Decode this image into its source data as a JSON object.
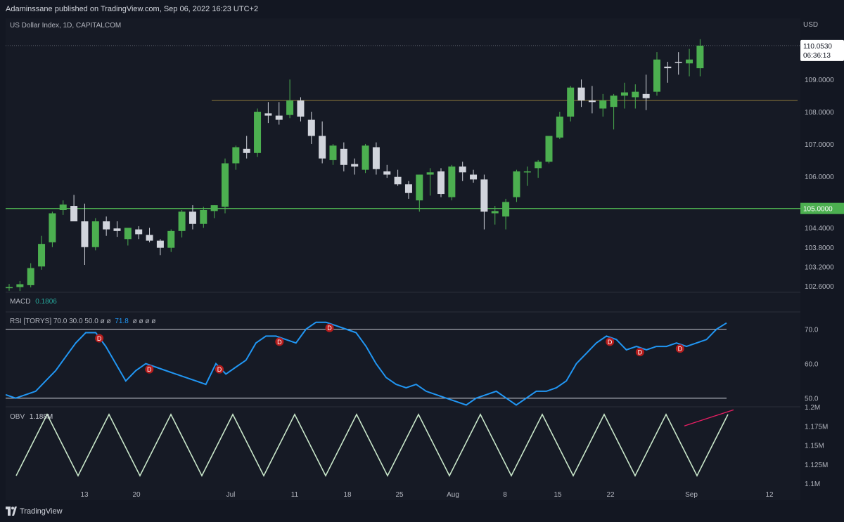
{
  "header": {
    "publisher": "Adaminssane published on TradingView.com, Sep 06, 2022 16:23 UTC+2"
  },
  "main_pane": {
    "symbol_title": "US Dollar Index, 1D, CAPITALCOM",
    "currency": "USD",
    "last_price": "110.0530",
    "countdown": "06:36:13",
    "support_label": "105.0000",
    "price_ticks": [
      "109.0000",
      "108.0000",
      "107.0000",
      "106.0000",
      "104.4000",
      "103.8000",
      "103.2000",
      "102.6000"
    ]
  },
  "macd": {
    "label": "MACD",
    "value": "0.1806"
  },
  "rsi": {
    "label": "RSI [TORYS] 70.0 30.0 50.0 ø ø",
    "value": "71.8",
    "tail": "ø ø ø ø",
    "ticks": [
      "70.0",
      "60.0",
      "50.0"
    ],
    "divergence_marker": "D"
  },
  "obv": {
    "label": "OBV",
    "value": "1.188M",
    "ticks": [
      "1.2M",
      "1.175M",
      "1.15M",
      "1.125M",
      "1.1M"
    ]
  },
  "time_axis": [
    "13",
    "20",
    "Jul",
    "11",
    "18",
    "25",
    "Aug",
    "8",
    "15",
    "22",
    "Sep",
    "12"
  ],
  "footer": {
    "brand": "TradingView"
  },
  "colors": {
    "up": "#4caf50",
    "down": "#d1d4dc",
    "rsi": "#2196f3",
    "obv": "#c8e6c9",
    "support": "#4caf50",
    "resistance": "#8d7a3a",
    "divergence": "#b71c1c",
    "trendline": "#e91e63"
  },
  "chart_data": [
    {
      "type": "candlestick",
      "title": "US Dollar Index, 1D, CAPITALCOM",
      "ylabel": "USD",
      "ylim": [
        102.4,
        110.9
      ],
      "x": [
        "Jun 8",
        "Jun 9",
        "Jun 10",
        "Jun 13",
        "Jun 14",
        "Jun 15",
        "Jun 16",
        "Jun 17",
        "Jun 20",
        "Jun 21",
        "Jun 22",
        "Jun 23",
        "Jun 24",
        "Jun 27",
        "Jun 28",
        "Jun 29",
        "Jun 30",
        "Jul 1",
        "Jul 4",
        "Jul 5",
        "Jul 6",
        "Jul 7",
        "Jul 8",
        "Jul 11",
        "Jul 12",
        "Jul 13",
        "Jul 14",
        "Jul 15",
        "Jul 18",
        "Jul 19",
        "Jul 20",
        "Jul 21",
        "Jul 22",
        "Jul 25",
        "Jul 26",
        "Jul 27",
        "Jul 28",
        "Jul 29",
        "Aug 1",
        "Aug 2",
        "Aug 3",
        "Aug 4",
        "Aug 5",
        "Aug 8",
        "Aug 9",
        "Aug 10",
        "Aug 11",
        "Aug 12",
        "Aug 15",
        "Aug 16",
        "Aug 17",
        "Aug 18",
        "Aug 19",
        "Aug 22",
        "Aug 23",
        "Aug 24",
        "Aug 25",
        "Aug 26",
        "Aug 29",
        "Aug 30",
        "Aug 31",
        "Sep 1",
        "Sep 2",
        "Sep 5",
        "Sep 6"
      ],
      "ohlc": [
        [
          102.55,
          102.66,
          102.45,
          102.56
        ],
        [
          102.56,
          102.75,
          102.44,
          102.65
        ],
        [
          102.62,
          103.3,
          102.55,
          103.15
        ],
        [
          103.2,
          104.15,
          103.1,
          103.9
        ],
        [
          103.95,
          104.9,
          103.8,
          104.85
        ],
        [
          104.95,
          105.25,
          104.8,
          105.12
        ],
        [
          105.08,
          105.42,
          104.85,
          104.6
        ],
        [
          104.6,
          105.15,
          103.25,
          103.8
        ],
        [
          103.8,
          104.7,
          103.7,
          104.6
        ],
        [
          104.6,
          104.75,
          104.15,
          104.35
        ],
        [
          104.38,
          104.6,
          104.12,
          104.3
        ],
        [
          104.05,
          104.35,
          103.85,
          104.4
        ],
        [
          104.35,
          104.45,
          104.05,
          104.2
        ],
        [
          104.18,
          104.4,
          103.95,
          104.0
        ],
        [
          104.0,
          104.05,
          103.55,
          103.78
        ],
        [
          103.78,
          104.35,
          103.65,
          104.3
        ],
        [
          104.3,
          104.95,
          104.1,
          104.9
        ],
        [
          104.9,
          105.1,
          104.35,
          104.52
        ],
        [
          104.52,
          105.05,
          104.4,
          104.95
        ],
        [
          104.92,
          105.1,
          104.7,
          105.1
        ],
        [
          105.05,
          106.55,
          104.85,
          106.4
        ],
        [
          106.4,
          106.95,
          106.2,
          106.9
        ],
        [
          106.85,
          107.25,
          106.55,
          106.72
        ],
        [
          106.72,
          108.1,
          106.6,
          108.0
        ],
        [
          107.95,
          108.3,
          107.65,
          107.88
        ],
        [
          107.88,
          108.3,
          107.6,
          107.75
        ],
        [
          107.9,
          109.0,
          107.8,
          108.35
        ],
        [
          108.35,
          108.45,
          107.7,
          107.85
        ],
        [
          107.75,
          108.0,
          107.0,
          107.25
        ],
        [
          107.25,
          107.7,
          106.4,
          106.55
        ],
        [
          106.5,
          107.0,
          106.35,
          106.95
        ],
        [
          106.85,
          107.05,
          106.15,
          106.35
        ],
        [
          106.38,
          106.55,
          106.05,
          106.3
        ],
        [
          106.2,
          107.0,
          106.1,
          106.95
        ],
        [
          106.9,
          107.05,
          106.05,
          106.22
        ],
        [
          106.15,
          106.35,
          105.95,
          106.05
        ],
        [
          105.98,
          106.2,
          105.7,
          105.75
        ],
        [
          105.75,
          105.85,
          105.3,
          105.48
        ],
        [
          105.25,
          106.05,
          104.9,
          106.05
        ],
        [
          106.05,
          106.25,
          105.4,
          106.12
        ],
        [
          106.15,
          106.25,
          105.35,
          105.45
        ],
        [
          105.35,
          106.35,
          105.25,
          106.3
        ],
        [
          106.3,
          106.45,
          105.85,
          106.12
        ],
        [
          106.05,
          106.2,
          105.8,
          105.9
        ],
        [
          105.9,
          106.05,
          104.35,
          104.9
        ],
        [
          104.85,
          105.08,
          104.5,
          104.92
        ],
        [
          104.75,
          105.3,
          104.35,
          105.2
        ],
        [
          105.35,
          106.2,
          105.2,
          106.15
        ],
        [
          106.12,
          106.3,
          105.7,
          106.15
        ],
        [
          106.25,
          106.5,
          105.95,
          106.45
        ],
        [
          106.45,
          107.25,
          106.4,
          107.25
        ],
        [
          107.2,
          108.0,
          107.15,
          107.85
        ],
        [
          107.85,
          108.8,
          107.7,
          108.75
        ],
        [
          108.75,
          109.0,
          108.15,
          108.35
        ],
        [
          108.35,
          108.8,
          107.95,
          108.3
        ],
        [
          108.1,
          108.55,
          107.85,
          108.35
        ],
        [
          108.15,
          108.55,
          107.45,
          108.5
        ],
        [
          108.5,
          108.9,
          108.1,
          108.6
        ],
        [
          108.45,
          108.85,
          108.1,
          108.62
        ],
        [
          108.55,
          109.15,
          108.05,
          108.42
        ],
        [
          108.62,
          109.85,
          108.5,
          109.62
        ],
        [
          109.4,
          109.55,
          108.9,
          109.35
        ],
        [
          109.55,
          109.85,
          109.15,
          109.52
        ],
        [
          109.5,
          109.95,
          109.1,
          109.62
        ],
        [
          109.35,
          110.25,
          109.1,
          110.05
        ]
      ],
      "horizontal_levels": [
        105.0,
        108.35,
        110.053
      ]
    },
    {
      "type": "line",
      "title": "RSI [TORYS]",
      "ylim": [
        47.5,
        75
      ],
      "levels": [
        70.0,
        50.0
      ],
      "series": [
        {
          "name": "RSI",
          "values": [
            51,
            50,
            51,
            52,
            55,
            58,
            62,
            66,
            69,
            69,
            65,
            60,
            55,
            58,
            60,
            59,
            58,
            57,
            56,
            55,
            54,
            60,
            57,
            59,
            61,
            66,
            68,
            68,
            67,
            66,
            70,
            72,
            72,
            71,
            70,
            69,
            65,
            60,
            56,
            54,
            53,
            54,
            52,
            51,
            50,
            49,
            48,
            50,
            51,
            52,
            50,
            48,
            50,
            52,
            52,
            53,
            55,
            60,
            63,
            66,
            68,
            67,
            64,
            65,
            64,
            65,
            65,
            66,
            65,
            66,
            67,
            70,
            71.8
          ]
        }
      ],
      "divergence_markers": 8
    },
    {
      "type": "line",
      "title": "OBV",
      "ylim": [
        1.1,
        1.2
      ],
      "series": [
        {
          "name": "OBV",
          "values": [
            1.1
          ]
        }
      ]
    }
  ]
}
